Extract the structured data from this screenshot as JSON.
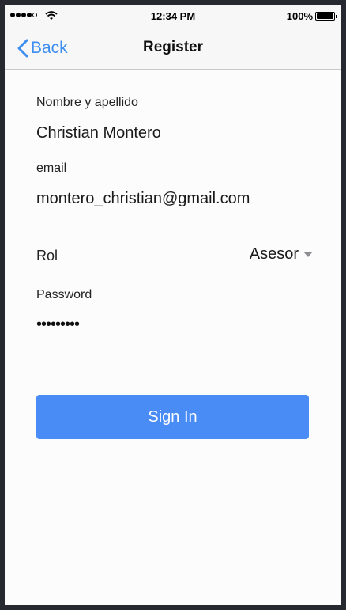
{
  "status_bar": {
    "time": "12:34 PM",
    "battery": "100%"
  },
  "nav": {
    "back_label": "Back",
    "title": "Register"
  },
  "form": {
    "name_label": "Nombre y apellido",
    "name_value": "Christian Montero",
    "email_label": "email",
    "email_value": "montero_christian@gmail.com",
    "rol_label": "Rol",
    "rol_value": "Asesor",
    "password_label": "Password",
    "password_value": "•••••••••"
  },
  "actions": {
    "signin_label": "Sign In"
  },
  "colors": {
    "accent": "#3d8ef0",
    "button": "#4a8cf5"
  }
}
